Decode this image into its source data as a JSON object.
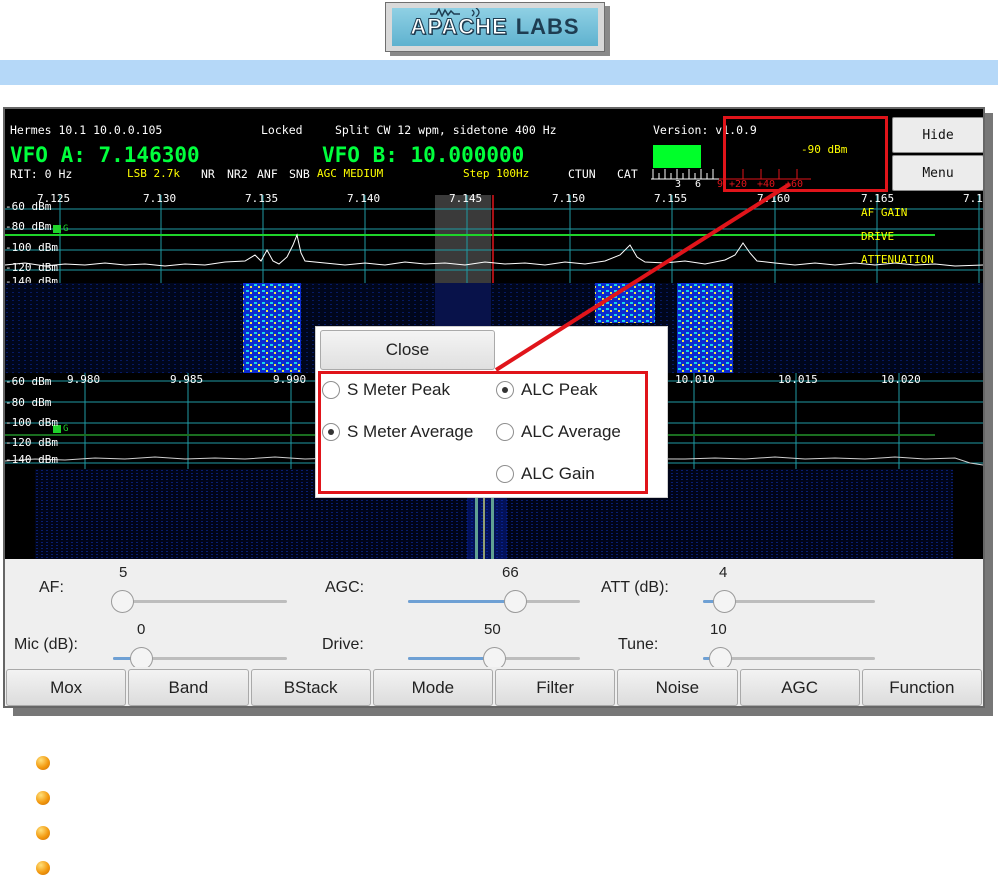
{
  "logo": {
    "brand_left": "APACHE",
    "brand_right": "LABS"
  },
  "header": {
    "device": "Hermes 10.1 10.0.0.105",
    "lock": "Locked",
    "split": "Split CW 12 wpm, sidetone 400 Hz",
    "version": "Version: v1.0.9",
    "vfo_a": "VFO A: 7.146300",
    "vfo_b": "VFO B: 10.000000",
    "rit": "RIT: 0 Hz",
    "mode": "LSB 2.7k",
    "nr": "NR",
    "nr2": "NR2",
    "anf": "ANF",
    "snb": "SNB",
    "agc": "AGC MEDIUM",
    "step": "Step 100Hz",
    "ctun": "CTUN",
    "cat": "CAT",
    "meter_dbm": "-90 dBm",
    "meter_scale": [
      "3",
      "6",
      "9",
      "+20",
      "+40",
      "+60"
    ]
  },
  "side": {
    "hide_label": "Hide",
    "menu_label": "Menu"
  },
  "panA": {
    "freqs": [
      "7.125",
      "7.130",
      "7.135",
      "7.140",
      "7.145",
      "7.150",
      "7.155",
      "7.160",
      "7.165",
      "7.1"
    ],
    "dbm": [
      "-60 dBm",
      "-80 dBm",
      "-100 dBm",
      "-120 dBm",
      "-140 dBm"
    ],
    "marker": "G",
    "meters": [
      "AF GAIN",
      "DRIVE",
      "ATTENUATION"
    ]
  },
  "panB": {
    "freqs": [
      "9.980",
      "9.985",
      "9.990",
      "10.010",
      "10.015",
      "10.020"
    ],
    "dbm": [
      "-60 dBm",
      "-80 dBm",
      "-100 dBm",
      "-120 dBm",
      "-140 dBm"
    ],
    "marker": "G"
  },
  "dialog": {
    "close": "Close",
    "s_meter_peak": "S Meter Peak",
    "s_meter_avg": "S Meter Average",
    "alc_peak": "ALC Peak",
    "alc_avg": "ALC Average",
    "alc_gain": "ALC Gain",
    "selected": [
      "S Meter Average",
      "ALC Peak"
    ]
  },
  "controls": {
    "af": {
      "label": "AF:",
      "value": "5",
      "level": 0.05
    },
    "agc": {
      "label": "AGC:",
      "value": "66",
      "level": 0.62
    },
    "att": {
      "label": "ATT (dB):",
      "value": "4",
      "level": 0.12
    },
    "mic": {
      "label": "Mic (dB):",
      "value": "0",
      "level": 0.16
    },
    "drive": {
      "label": "Drive:",
      "value": "50",
      "level": 0.5
    },
    "tune": {
      "label": "Tune:",
      "value": "10",
      "level": 0.1
    }
  },
  "buttons": [
    "Mox",
    "Band",
    "BStack",
    "Mode",
    "Filter",
    "Noise",
    "AGC",
    "Function"
  ],
  "colors": {
    "vfo": "#00ff3c",
    "status": "#ffff00",
    "accent_red": "#e0141a",
    "slider": "#6ea0d4"
  }
}
